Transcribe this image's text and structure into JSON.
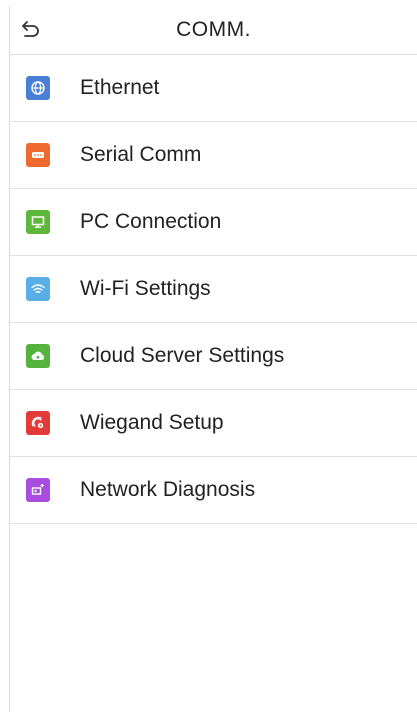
{
  "header": {
    "title": "COMM."
  },
  "menu": {
    "items": [
      {
        "label": "Ethernet",
        "icon": "ethernet-globe-icon",
        "color": "#4a7fd6"
      },
      {
        "label": "Serial Comm",
        "icon": "serial-port-icon",
        "color": "#f06a2e"
      },
      {
        "label": "PC Connection",
        "icon": "pc-connection-icon",
        "color": "#5fb63c"
      },
      {
        "label": "Wi-Fi Settings",
        "icon": "wifi-icon",
        "color": "#5aaee6"
      },
      {
        "label": "Cloud Server Settings",
        "icon": "cloud-server-icon",
        "color": "#54b33d"
      },
      {
        "label": "Wiegand Setup",
        "icon": "wiegand-icon",
        "color": "#e23b3b"
      },
      {
        "label": "Network Diagnosis",
        "icon": "network-diagnosis-icon",
        "color": "#a94de0"
      }
    ]
  }
}
